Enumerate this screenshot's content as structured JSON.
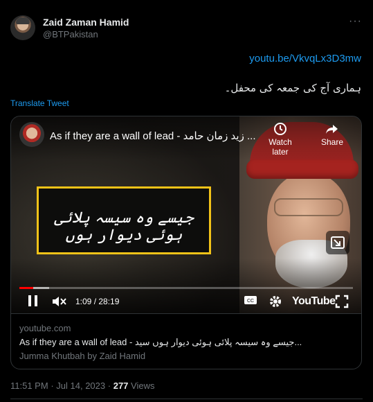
{
  "tweet": {
    "author_name": "Zaid Zaman Hamid",
    "author_handle": "@BTPakistan",
    "more_icon": "ellipsis-icon",
    "link_text": "youtu.be/VkvqLx3D3mw",
    "body_text": "ہماری آج کی جمعہ کی محفل۔",
    "translate_label": "Translate Tweet"
  },
  "video": {
    "title": "As if they are a wall of lead - زید زمان حامد ...",
    "watch_later_label": "Watch later",
    "share_label": "Share",
    "overlay_text": "جیسے وہ سیسہ پلائی ہوئی دیوار ہوں",
    "time_display": "1:09 / 28:19",
    "progress_fraction": 0.0406,
    "brand": "YouTube",
    "icons": [
      "play-icon",
      "mute-icon",
      "captions-icon",
      "settings-icon",
      "fullscreen-icon",
      "clock-icon",
      "share-icon",
      "pip-icon"
    ]
  },
  "card": {
    "domain": "youtube.com",
    "title": "As if they are a wall of lead - جیسے وہ سیسہ پلائی ہوئی دیوار ہوں سید...",
    "description": "Jumma Khutbah by Zaid Hamid"
  },
  "footer": {
    "time": "11:51 PM",
    "separator": "·",
    "date": "Jul 14, 2023",
    "views_count": "277",
    "views_label": "Views"
  },
  "colors": {
    "accent": "#1d9bf0",
    "progress": "#ff0000",
    "box_border": "#f3c318",
    "muted": "#71767b"
  }
}
